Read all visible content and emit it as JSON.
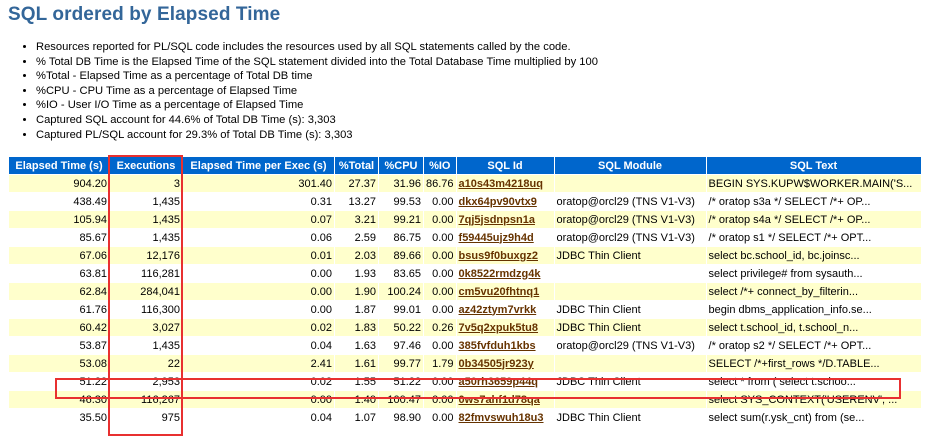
{
  "title": "SQL ordered by Elapsed Time",
  "notes": [
    "Resources reported for PL/SQL code includes the resources used by all SQL statements called by the code.",
    "% Total DB Time is the Elapsed Time of the SQL statement divided into the Total Database Time multiplied by 100",
    "%Total - Elapsed Time as a percentage of Total DB time",
    "%CPU - CPU Time as a percentage of Elapsed Time",
    "%IO - User I/O Time as a percentage of Elapsed Time",
    "Captured SQL account for 44.6% of Total DB Time (s): 3,303",
    "Captured PL/SQL account for 29.3% of Total DB Time (s): 3,303"
  ],
  "columns": [
    "Elapsed Time (s)",
    "Executions",
    "Elapsed Time per Exec (s)",
    "%Total",
    "%CPU",
    "%IO",
    "SQL Id",
    "SQL Module",
    "SQL Text"
  ],
  "highlight_color": "#e83030",
  "header_color": "#0066cc",
  "rows": [
    {
      "elapsed": "904.20",
      "executions": "3",
      "per_exec": "301.40",
      "pct_total": "27.37",
      "pct_cpu": "31.96",
      "pct_io": "86.76",
      "sql_id": "a10s43m4218uq",
      "module": "",
      "text": "BEGIN SYS.KUPW$WORKER.MAIN('S..."
    },
    {
      "elapsed": "438.49",
      "executions": "1,435",
      "per_exec": "0.31",
      "pct_total": "13.27",
      "pct_cpu": "99.53",
      "pct_io": "0.00",
      "sql_id": "dkx64pv90vtx9",
      "module": "oratop@orcl29 (TNS V1-V3)",
      "text": "/* oratop s3a */ SELECT /*+ OP..."
    },
    {
      "elapsed": "105.94",
      "executions": "1,435",
      "per_exec": "0.07",
      "pct_total": "3.21",
      "pct_cpu": "99.21",
      "pct_io": "0.00",
      "sql_id": "7qj5jsdnpsn1a",
      "module": "oratop@orcl29 (TNS V1-V3)",
      "text": "/* oratop s4a */ SELECT /*+ OP..."
    },
    {
      "elapsed": "85.67",
      "executions": "1,435",
      "per_exec": "0.06",
      "pct_total": "2.59",
      "pct_cpu": "86.75",
      "pct_io": "0.00",
      "sql_id": "f59445ujz9h4d",
      "module": "oratop@orcl29 (TNS V1-V3)",
      "text": "/* oratop s1 */ SELECT /*+ OPT..."
    },
    {
      "elapsed": "67.06",
      "executions": "12,176",
      "per_exec": "0.01",
      "pct_total": "2.03",
      "pct_cpu": "89.66",
      "pct_io": "0.00",
      "sql_id": "bsus9f0buxgz2",
      "module": "JDBC Thin Client",
      "text": "select bc.school_id, bc.joinsc..."
    },
    {
      "elapsed": "63.81",
      "executions": "116,281",
      "per_exec": "0.00",
      "pct_total": "1.93",
      "pct_cpu": "83.65",
      "pct_io": "0.00",
      "sql_id": "0k8522rmdzg4k",
      "module": "",
      "text": "select privilege# from sysauth..."
    },
    {
      "elapsed": "62.84",
      "executions": "284,041",
      "per_exec": "0.00",
      "pct_total": "1.90",
      "pct_cpu": "100.24",
      "pct_io": "0.00",
      "sql_id": "cm5vu20fhtnq1",
      "module": "",
      "text": "select /*+ connect_by_filterin..."
    },
    {
      "elapsed": "61.76",
      "executions": "116,300",
      "per_exec": "0.00",
      "pct_total": "1.87",
      "pct_cpu": "99.01",
      "pct_io": "0.00",
      "sql_id": "az42ztym7vrkk",
      "module": "JDBC Thin Client",
      "text": "begin dbms_application_info.se..."
    },
    {
      "elapsed": "60.42",
      "executions": "3,027",
      "per_exec": "0.02",
      "pct_total": "1.83",
      "pct_cpu": "50.22",
      "pct_io": "0.26",
      "sql_id": "7v5q2xpuk5tu8",
      "module": "JDBC Thin Client",
      "text": "select t.school_id, t.school_n..."
    },
    {
      "elapsed": "53.87",
      "executions": "1,435",
      "per_exec": "0.04",
      "pct_total": "1.63",
      "pct_cpu": "97.46",
      "pct_io": "0.00",
      "sql_id": "385fvfduh1kbs",
      "module": "oratop@orcl29 (TNS V1-V3)",
      "text": "/* oratop s2 */ SELECT /*+ OPT..."
    },
    {
      "elapsed": "53.08",
      "executions": "22",
      "per_exec": "2.41",
      "pct_total": "1.61",
      "pct_cpu": "99.77",
      "pct_io": "1.79",
      "sql_id": "0b34505jr923y",
      "module": "",
      "text": "SELECT /*+first_rows */D.TABLE..."
    },
    {
      "elapsed": "51.22",
      "executions": "2,953",
      "per_exec": "0.02",
      "pct_total": "1.55",
      "pct_cpu": "51.22",
      "pct_io": "0.00",
      "sql_id": "a50rh3659p44q",
      "module": "JDBC Thin Client",
      "text": "select * from ( select t.schoo..."
    },
    {
      "elapsed": "46.30",
      "executions": "116,267",
      "per_exec": "0.00",
      "pct_total": "1.40",
      "pct_cpu": "100.47",
      "pct_io": "0.00",
      "sql_id": "0ws7ahf1d78qa",
      "module": "",
      "text": "select SYS_CONTEXT('USERENV', ..."
    },
    {
      "elapsed": "35.50",
      "executions": "975",
      "per_exec": "0.04",
      "pct_total": "1.07",
      "pct_cpu": "98.90",
      "pct_io": "0.00",
      "sql_id": "82fmvswuh18u3",
      "module": "JDBC Thin Client",
      "text": "select sum(r.ysk_cnt) from (se..."
    }
  ]
}
